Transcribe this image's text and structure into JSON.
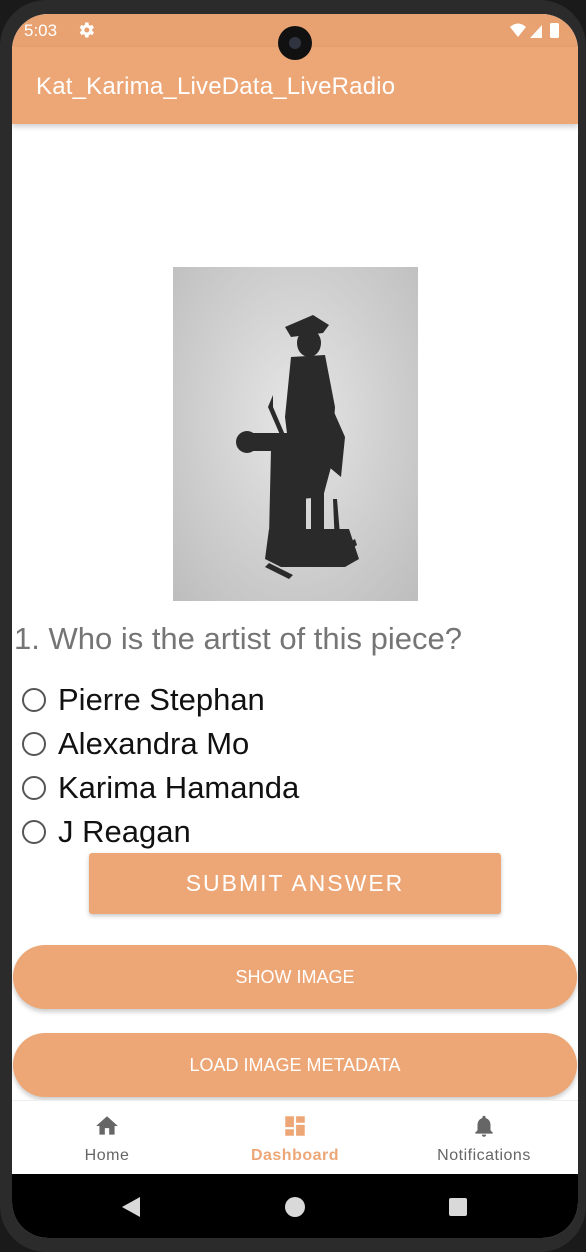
{
  "status_bar": {
    "time": "5:03"
  },
  "app_bar": {
    "title": "Kat_Karima_LiveData_LiveRadio"
  },
  "quiz": {
    "question": "1. Who is the artist of this piece?",
    "options": [
      "Pierre Stephan",
      "Alexandra Mo",
      "Karima Hamanda",
      "J Reagan"
    ],
    "submit_label": "SUBMIT ANSWER"
  },
  "actions": {
    "show_image_label": "SHOW IMAGE",
    "load_metadata_label": "LOAD IMAGE METADATA"
  },
  "bottom_nav": {
    "items": [
      {
        "label": "Home",
        "icon": "home-icon"
      },
      {
        "label": "Dashboard",
        "icon": "dashboard-icon"
      },
      {
        "label": "Notifications",
        "icon": "bell-icon"
      }
    ],
    "active_index": 1
  },
  "colors": {
    "accent": "#eda777",
    "status_bar": "#e8a271"
  }
}
